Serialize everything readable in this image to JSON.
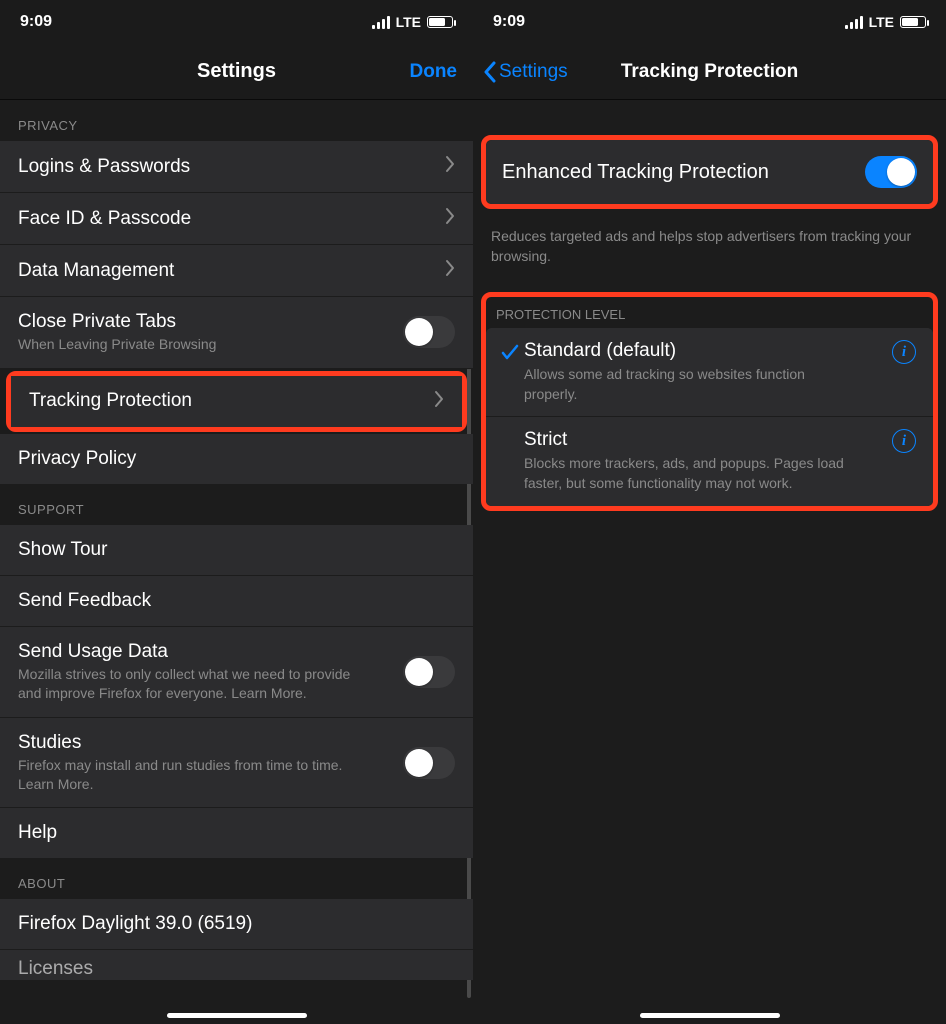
{
  "status": {
    "time": "9:09",
    "network": "LTE"
  },
  "left": {
    "nav_title": "Settings",
    "done": "Done",
    "sections": {
      "privacy": {
        "header": "PRIVACY",
        "logins": "Logins & Passwords",
        "faceid": "Face ID & Passcode",
        "data_mgmt": "Data Management",
        "close_tabs": "Close Private Tabs",
        "close_tabs_sub": "When Leaving Private Browsing",
        "tracking": "Tracking Protection",
        "privacy_policy": "Privacy Policy"
      },
      "support": {
        "header": "SUPPORT",
        "tour": "Show Tour",
        "feedback": "Send Feedback",
        "usage": "Send Usage Data",
        "usage_sub": "Mozilla strives to only collect what we need to provide and improve Firefox for everyone. Learn More.",
        "studies": "Studies",
        "studies_sub": "Firefox may install and run studies from time to time. Learn More.",
        "help": "Help"
      },
      "about": {
        "header": "ABOUT",
        "version": "Firefox Daylight 39.0 (6519)",
        "licenses": "Licenses"
      }
    }
  },
  "right": {
    "back": "Settings",
    "title": "Tracking Protection",
    "etp": {
      "label": "Enhanced Tracking Protection",
      "desc": "Reduces targeted ads and helps stop advertisers from tracking your browsing."
    },
    "level_header": "PROTECTION LEVEL",
    "standard": {
      "label": "Standard (default)",
      "desc": "Allows some ad tracking so websites function properly."
    },
    "strict": {
      "label": "Strict",
      "desc": "Blocks more trackers, ads, and popups. Pages load faster, but some functionality may not work."
    }
  }
}
